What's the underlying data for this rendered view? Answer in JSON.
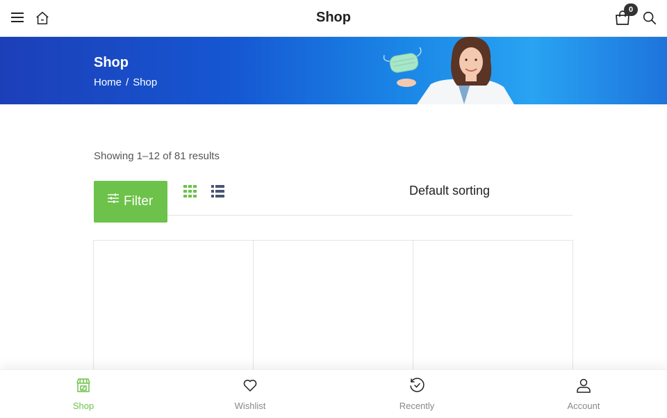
{
  "header": {
    "title": "Shop",
    "cart_count": "0",
    "icons": [
      "menu-icon",
      "home-icon",
      "cart-icon",
      "search-icon"
    ]
  },
  "hero": {
    "title": "Shop",
    "breadcrumb": {
      "home": "Home",
      "separator": "/",
      "current": "Shop"
    }
  },
  "toolbar": {
    "result_count": "Showing 1–12 of 81 results",
    "filter_label": "Filter",
    "sorting_label": "Default sorting"
  },
  "bottom_nav": {
    "items": [
      {
        "label": "Shop",
        "icon": "store-icon",
        "active": true
      },
      {
        "label": "Wishlist",
        "icon": "heart-icon",
        "active": false
      },
      {
        "label": "Recently",
        "icon": "history-icon",
        "active": false
      },
      {
        "label": "Account",
        "icon": "user-icon",
        "active": false
      }
    ]
  },
  "colors": {
    "accent": "#6cc24a",
    "hero_blue": "#1657d2",
    "text": "#222222"
  }
}
